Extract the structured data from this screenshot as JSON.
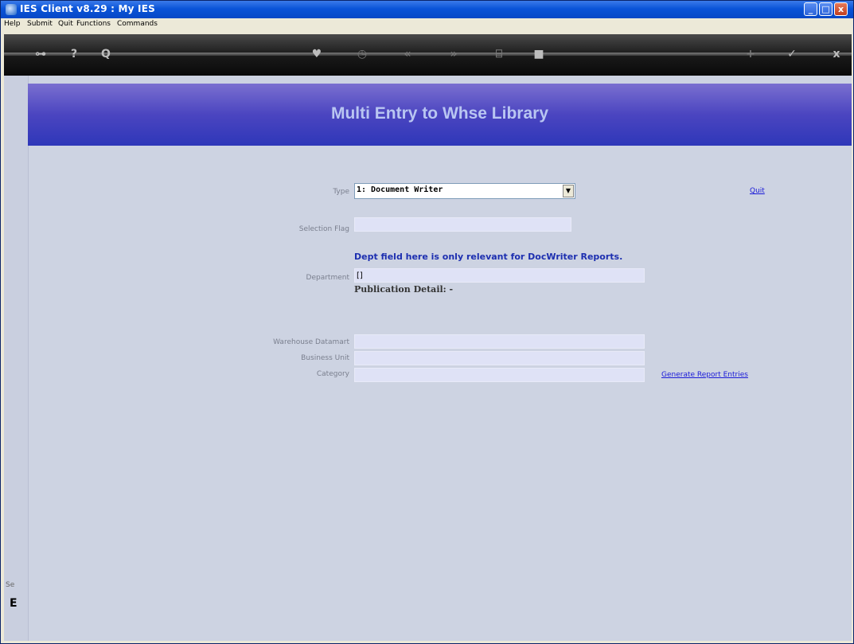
{
  "window": {
    "title": "IES Client v8.29 : My IES",
    "buttons": {
      "minimize": "_",
      "maximize": "□",
      "close": "x"
    }
  },
  "menu": [
    "Help",
    "Submit",
    "Quit",
    "Functions",
    "Commands"
  ],
  "toolbar": {
    "icons": [
      "key-icon",
      "help-icon",
      "search-icon",
      "heart-icon",
      "clock-icon",
      "back-icon",
      "forward-icon",
      "copy-icon",
      "stop-icon",
      "add-icon",
      "ok-icon",
      "close-icon"
    ],
    "glyphs": {
      "key": "⊶",
      "help": "?",
      "search": "Q",
      "heart": "♥",
      "clock": "◷",
      "back": "«",
      "forward": "»",
      "copy": "⌸",
      "stop": "■",
      "add": "+",
      "ok": "✓",
      "close": "x"
    }
  },
  "page": {
    "heading": "Multi Entry to Whse Library",
    "labels": {
      "type": "Type",
      "selection_flag": "Selection Flag",
      "department": "Department",
      "warehouse_datamart": "Warehouse Datamart",
      "business_unit": "Business Unit",
      "category": "Category"
    },
    "type_value": "1: Document Writer",
    "department_value": "[]",
    "note": "Dept field here is only relevant for  DocWriter Reports.",
    "publication_detail": "Publication Detail: -",
    "links": {
      "quit": "Quit",
      "generate": "Generate Report Entries"
    }
  },
  "side": {
    "label": "Se",
    "glyph": "E"
  }
}
